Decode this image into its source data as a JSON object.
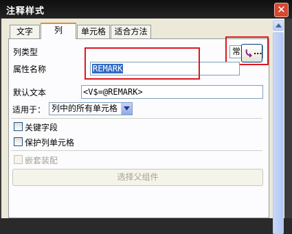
{
  "window": {
    "title": "注释样式"
  },
  "tabs": [
    {
      "label": "文字"
    },
    {
      "label": "列"
    },
    {
      "label": "单元格"
    },
    {
      "label": "适合方法"
    }
  ],
  "column_type": {
    "label": "列类型",
    "value": "常规"
  },
  "attribute_name": {
    "label": "属性名称",
    "value": "REMARK",
    "button_label": "..."
  },
  "default_text": {
    "label": "默认文本",
    "value": "<V$=@REMARK>"
  },
  "apply_to": {
    "label": "适用于：",
    "value": "列中的所有单元格"
  },
  "checkboxes": [
    {
      "label": "关键字段",
      "checked": false,
      "enabled": true
    },
    {
      "label": "保护列单元格",
      "checked": false,
      "enabled": true
    },
    {
      "label": "嵌套装配",
      "checked": false,
      "enabled": false
    }
  ],
  "select_parent_button": {
    "label": "选择父组件",
    "enabled": false
  },
  "colors": {
    "highlight": "#e0141e",
    "selection": "#316ac5",
    "close": "#d64830"
  }
}
